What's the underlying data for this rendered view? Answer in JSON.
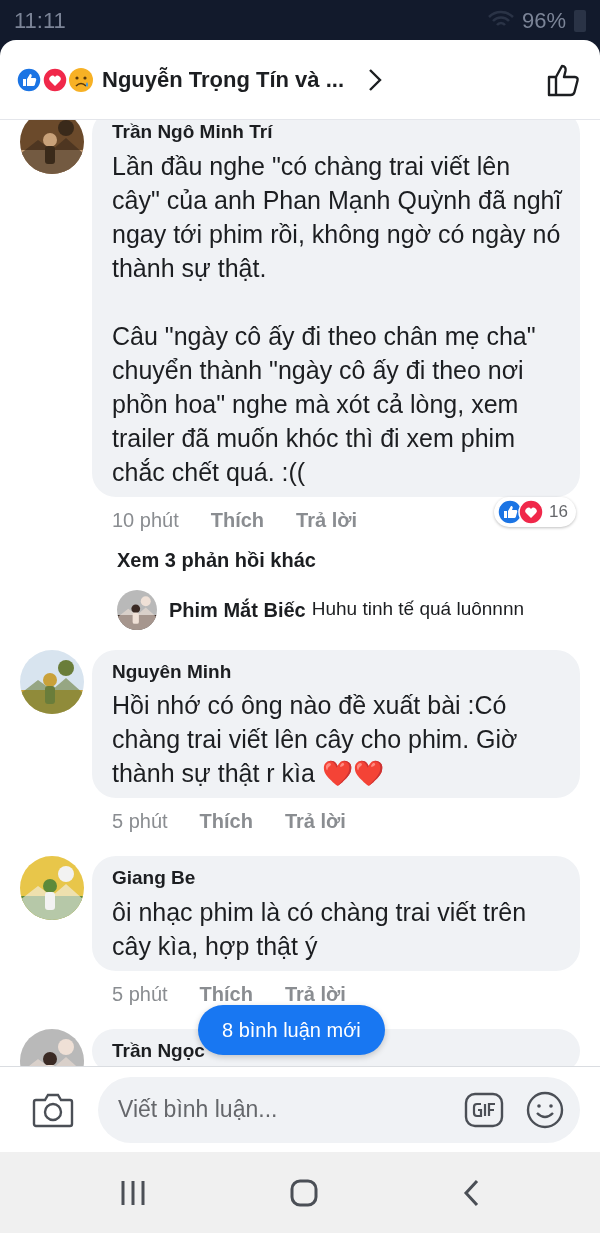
{
  "status_bar": {
    "time": "11:11",
    "battery": "96%"
  },
  "header": {
    "title": "Nguyễn Trọng Tín và ..."
  },
  "comments": [
    {
      "author": "Trần Ngô Minh Trí",
      "paragraphs": [
        "Lần đầu nghe \"có chàng trai viết lên cây\" của anh Phan Mạnh Quỳnh đã nghĩ ngay tới phim rồi, không ngờ có ngày nó thành sự thật.",
        "Câu \"ngày cô ấy đi theo chân mẹ cha\" chuyển thành \"ngày cô ấy đi theo nơi phồn hoa\" nghe mà xót cả lòng, xem trailer đã muốn khóc thì đi xem phim chắc chết quá. :(("
      ],
      "time": "10 phút",
      "like": "Thích",
      "reply": "Trả lời",
      "reaction_count": "16",
      "more_replies": "Xem 3 phản hồi khác",
      "replies": [
        {
          "author": "Phim Mắt Biếc",
          "text": "Huhu tinh tế quá luônnnn"
        }
      ]
    },
    {
      "author": "Nguyên Minh",
      "paragraphs": [
        "Hồi nhớ có ông nào đề xuất bài :Có chàng trai viết lên cây cho phim. Giờ thành sự thật r kìa ❤️❤️"
      ],
      "time": "5 phút",
      "like": "Thích",
      "reply": "Trả lời"
    },
    {
      "author": "Giang Be",
      "paragraphs": [
        "ôi nhạc phim là có chàng trai viết trên cây kìa, hợp thật ý"
      ],
      "time": "5 phút",
      "like": "Thích",
      "reply": "Trả lời"
    },
    {
      "author": "Trần Ngọc"
    }
  ],
  "new_comments_button": "8 bình luận mới",
  "composer": {
    "placeholder": "Viết bình luận..."
  }
}
